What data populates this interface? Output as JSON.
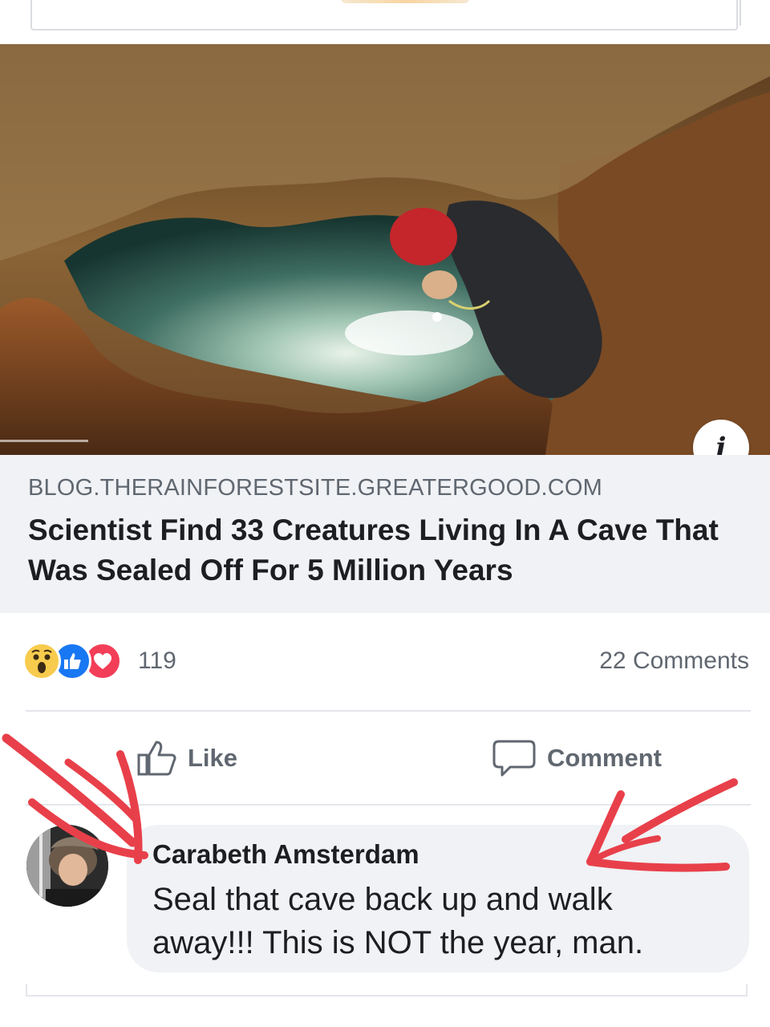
{
  "post": {
    "link": {
      "domain": "BLOG.THERAINFORESTSITE.GREATERGOOD.COM",
      "headline": "Scientist Find 33 Creatures Living In A Cave That Was Sealed Off For 5 Million Years",
      "image_icon": "cave-photo",
      "info_icon": "i"
    },
    "stats": {
      "reaction_icons": [
        "wow-reaction-icon",
        "like-reaction-icon",
        "love-reaction-icon"
      ],
      "reaction_count": "119",
      "comment_count": "22 Comments"
    },
    "actions": {
      "like_label": "Like",
      "comment_label": "Comment"
    },
    "comment": {
      "author": "Carabeth Amsterdam",
      "text": "Seal that cave back up and walk away!!! This is NOT the year, man."
    }
  },
  "colors": {
    "annotation_arrows": "#e8404a",
    "like_blue": "#1877f2",
    "love_red": "#f33e58",
    "wow_yellow": "#f7cb4d",
    "secondary_text": "#606770",
    "link_box_bg": "#f0f2f5"
  }
}
